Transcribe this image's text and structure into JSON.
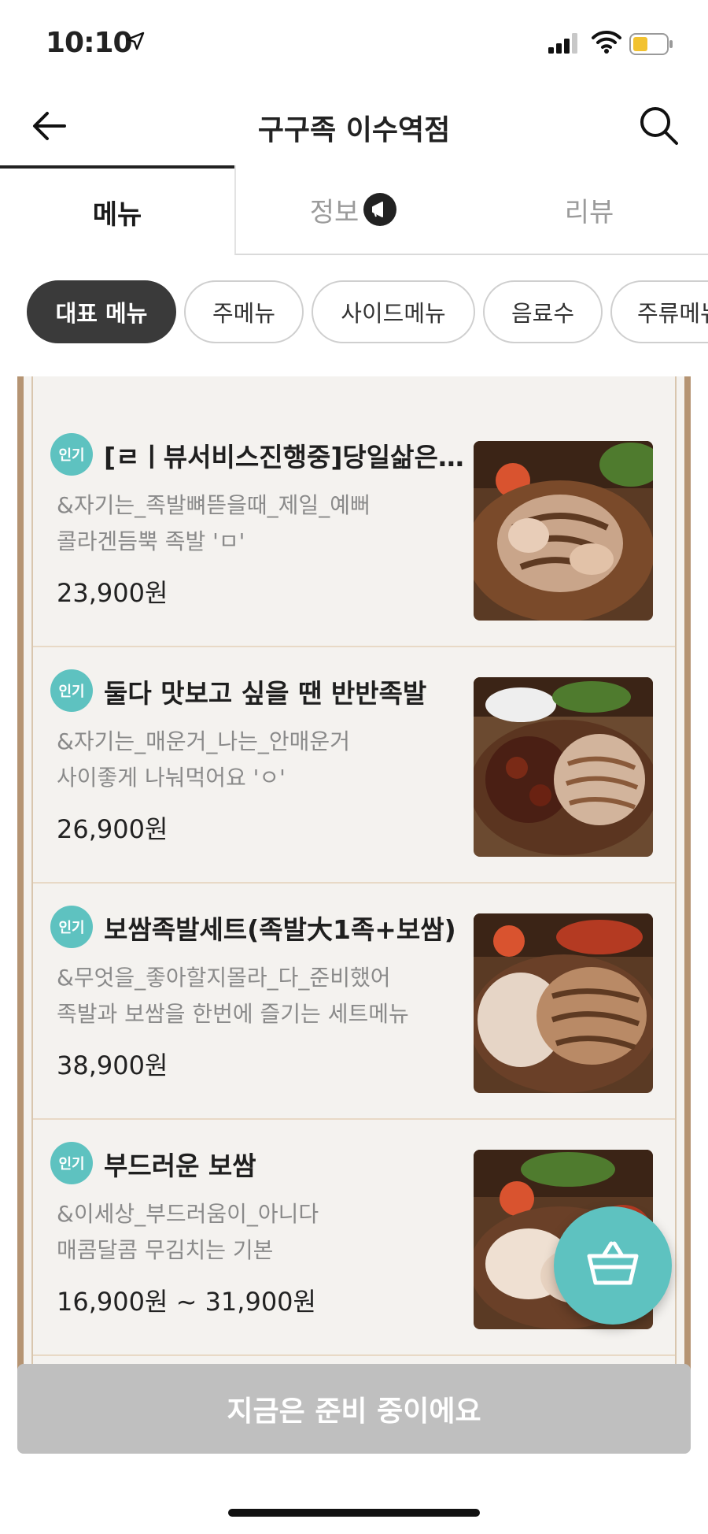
{
  "status_bar": {
    "time": "10:10"
  },
  "header": {
    "title": "구구족 이수역점"
  },
  "tabs": [
    {
      "label": "메뉴"
    },
    {
      "label": "정보"
    },
    {
      "label": "리뷰"
    }
  ],
  "categories": [
    "대표 메뉴",
    "주메뉴",
    "사이드메뉴",
    "음료수",
    "주류메뉴"
  ],
  "menu_items": [
    {
      "badge": "인기",
      "name": "[ㄹㅣ뷰서비스진행중]당일삶은 족발",
      "desc1": "&자기는_족발뼈뜯을때_제일_예뻐",
      "desc2": "콜라겐듬뿍 족발 'ㅁ'",
      "price": "23,900원"
    },
    {
      "badge": "인기",
      "name": "둘다 맛보고 싶을 땐 반반족발",
      "desc1": "&자기는_매운거_나는_안매운거",
      "desc2": "사이좋게 나눠먹어요 'ㅇ'",
      "price": "26,900원"
    },
    {
      "badge": "인기",
      "name": "보쌈족발세트(족발大1족+보쌈)",
      "desc1": "&무엇을_좋아할지몰라_다_준비했어",
      "desc2": "족발과 보쌈을 한번에 즐기는 세트메뉴",
      "price": "38,900원"
    },
    {
      "badge": "인기",
      "name": "부드러운 보쌈",
      "desc1": "&이세상_부드러움이_아니다",
      "desc2": "매콤달콤 무김치는 기본",
      "price": "16,900원 ~ 31,900원"
    }
  ],
  "cta": {
    "label": "지금은 준비 중이에요"
  },
  "colors": {
    "accent": "#5ec2c0",
    "chip_active": "#3a3a3a",
    "board_border": "#b59473"
  }
}
